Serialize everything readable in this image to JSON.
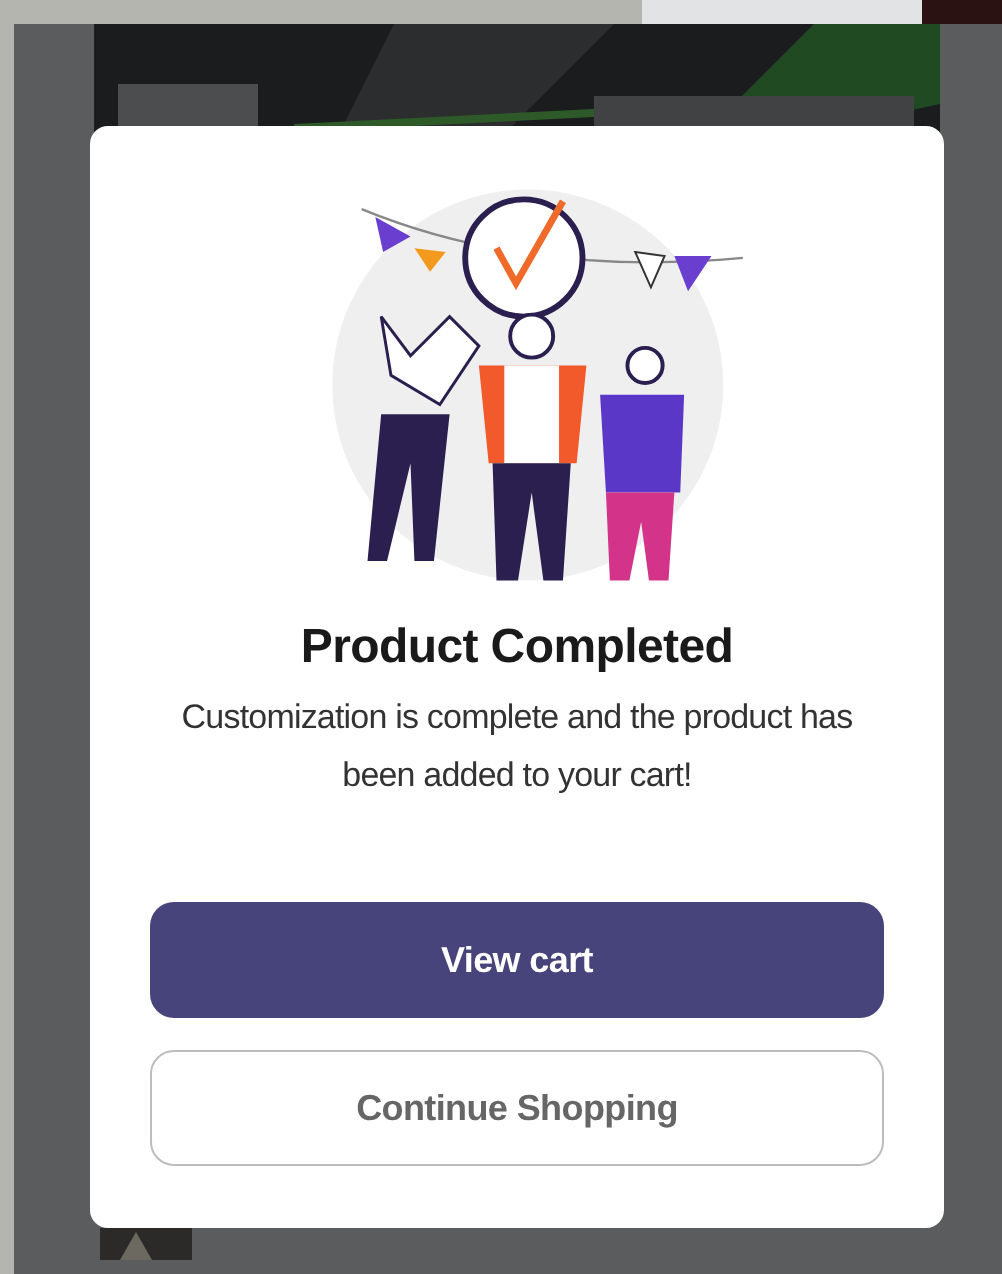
{
  "dialog": {
    "title": "Product Completed",
    "message": "Customization is complete and the product has been added to your cart!",
    "buttons": [
      {
        "label": "View cart",
        "kind": "primary"
      },
      {
        "label": "Continue Shopping",
        "kind": "secondary"
      }
    ]
  }
}
